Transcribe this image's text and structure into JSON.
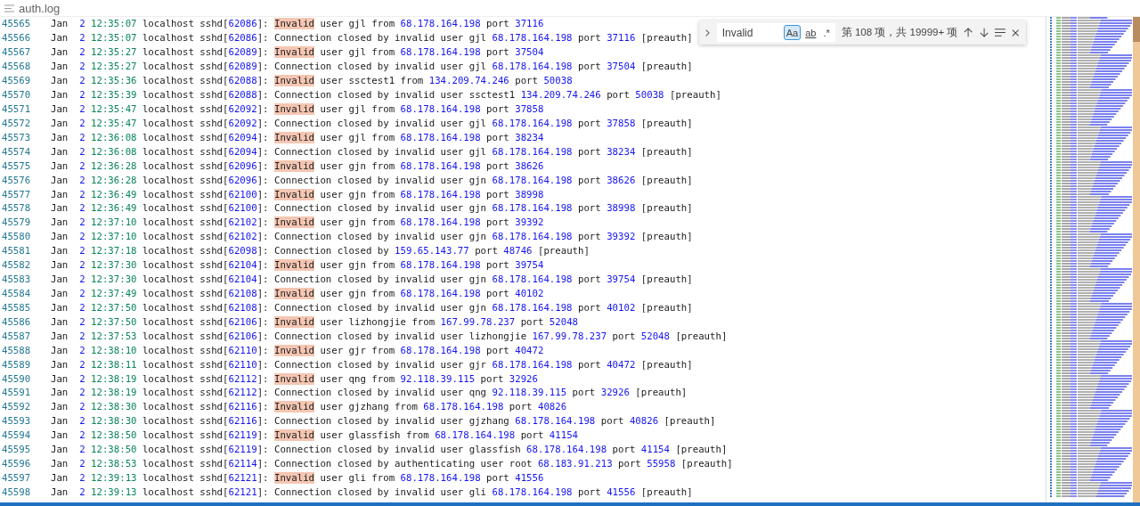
{
  "tab": {
    "title": "auth.log"
  },
  "find": {
    "value": "Invalid",
    "toggles": [
      {
        "label": "Aa",
        "kind": "case",
        "selected": true
      },
      {
        "label": "ab",
        "kind": "word",
        "selected": false
      },
      {
        "label": ".*",
        "kind": "regex",
        "selected": false
      }
    ],
    "results": "第 108 项，共 19999+ 项"
  },
  "lines": [
    {
      "number": "45565",
      "month": "Jan",
      "day": "2",
      "time": "12:35:07",
      "host": "localhost",
      "process": "sshd[",
      "pid": "62086",
      "close": "]:",
      "message": [
        {
          "kind": "match",
          "text": "Invalid"
        },
        {
          "kind": "text",
          "text": " user gjl from "
        },
        {
          "kind": "number",
          "text": "68.178.164.198"
        },
        {
          "kind": "text",
          "text": " port "
        },
        {
          "kind": "number",
          "text": "37116"
        }
      ]
    },
    {
      "number": "45566",
      "month": "Jan",
      "day": "2",
      "time": "12:35:07",
      "host": "localhost",
      "process": "sshd[",
      "pid": "62086",
      "close": "]:",
      "message": [
        {
          "kind": "text",
          "text": "Connection closed by invalid user gjl "
        },
        {
          "kind": "number",
          "text": "68.178.164.198"
        },
        {
          "kind": "text",
          "text": " port "
        },
        {
          "kind": "number",
          "text": "37116"
        },
        {
          "kind": "text",
          "text": " [preauth]"
        }
      ]
    },
    {
      "number": "45567",
      "month": "Jan",
      "day": "2",
      "time": "12:35:27",
      "host": "localhost",
      "process": "sshd[",
      "pid": "62089",
      "close": "]:",
      "message": [
        {
          "kind": "match",
          "text": "Invalid"
        },
        {
          "kind": "text",
          "text": " user gjl from "
        },
        {
          "kind": "number",
          "text": "68.178.164.198"
        },
        {
          "kind": "text",
          "text": " port "
        },
        {
          "kind": "number",
          "text": "37504"
        }
      ]
    },
    {
      "number": "45568",
      "month": "Jan",
      "day": "2",
      "time": "12:35:27",
      "host": "localhost",
      "process": "sshd[",
      "pid": "62089",
      "close": "]:",
      "message": [
        {
          "kind": "text",
          "text": "Connection closed by invalid user gjl "
        },
        {
          "kind": "number",
          "text": "68.178.164.198"
        },
        {
          "kind": "text",
          "text": " port "
        },
        {
          "kind": "number",
          "text": "37504"
        },
        {
          "kind": "text",
          "text": " [preauth]"
        }
      ]
    },
    {
      "number": "45569",
      "month": "Jan",
      "day": "2",
      "time": "12:35:36",
      "host": "localhost",
      "process": "sshd[",
      "pid": "62088",
      "close": "]:",
      "message": [
        {
          "kind": "match",
          "text": "Invalid"
        },
        {
          "kind": "text",
          "text": " user ssctest1 from "
        },
        {
          "kind": "number",
          "text": "134.209.74.246"
        },
        {
          "kind": "text",
          "text": " port "
        },
        {
          "kind": "number",
          "text": "50038"
        }
      ]
    },
    {
      "number": "45570",
      "month": "Jan",
      "day": "2",
      "time": "12:35:39",
      "host": "localhost",
      "process": "sshd[",
      "pid": "62088",
      "close": "]:",
      "message": [
        {
          "kind": "text",
          "text": "Connection closed by invalid user ssctest1 "
        },
        {
          "kind": "number",
          "text": "134.209.74.246"
        },
        {
          "kind": "text",
          "text": " port "
        },
        {
          "kind": "number",
          "text": "50038"
        },
        {
          "kind": "text",
          "text": " [preauth]"
        }
      ]
    },
    {
      "number": "45571",
      "month": "Jan",
      "day": "2",
      "time": "12:35:47",
      "host": "localhost",
      "process": "sshd[",
      "pid": "62092",
      "close": "]:",
      "message": [
        {
          "kind": "match",
          "text": "Invalid"
        },
        {
          "kind": "text",
          "text": " user gjl from "
        },
        {
          "kind": "number",
          "text": "68.178.164.198"
        },
        {
          "kind": "text",
          "text": " port "
        },
        {
          "kind": "number",
          "text": "37858"
        }
      ]
    },
    {
      "number": "45572",
      "month": "Jan",
      "day": "2",
      "time": "12:35:47",
      "host": "localhost",
      "process": "sshd[",
      "pid": "62092",
      "close": "]:",
      "message": [
        {
          "kind": "text",
          "text": "Connection closed by invalid user gjl "
        },
        {
          "kind": "number",
          "text": "68.178.164.198"
        },
        {
          "kind": "text",
          "text": " port "
        },
        {
          "kind": "number",
          "text": "37858"
        },
        {
          "kind": "text",
          "text": " [preauth]"
        }
      ]
    },
    {
      "number": "45573",
      "month": "Jan",
      "day": "2",
      "time": "12:36:08",
      "host": "localhost",
      "process": "sshd[",
      "pid": "62094",
      "close": "]:",
      "message": [
        {
          "kind": "match",
          "text": "Invalid"
        },
        {
          "kind": "text",
          "text": " user gjl from "
        },
        {
          "kind": "number",
          "text": "68.178.164.198"
        },
        {
          "kind": "text",
          "text": " port "
        },
        {
          "kind": "number",
          "text": "38234"
        }
      ]
    },
    {
      "number": "45574",
      "month": "Jan",
      "day": "2",
      "time": "12:36:08",
      "host": "localhost",
      "process": "sshd[",
      "pid": "62094",
      "close": "]:",
      "message": [
        {
          "kind": "text",
          "text": "Connection closed by invalid user gjl "
        },
        {
          "kind": "number",
          "text": "68.178.164.198"
        },
        {
          "kind": "text",
          "text": " port "
        },
        {
          "kind": "number",
          "text": "38234"
        },
        {
          "kind": "text",
          "text": " [preauth]"
        }
      ]
    },
    {
      "number": "45575",
      "month": "Jan",
      "day": "2",
      "time": "12:36:28",
      "host": "localhost",
      "process": "sshd[",
      "pid": "62096",
      "close": "]:",
      "message": [
        {
          "kind": "match",
          "text": "Invalid"
        },
        {
          "kind": "text",
          "text": " user gjn from "
        },
        {
          "kind": "number",
          "text": "68.178.164.198"
        },
        {
          "kind": "text",
          "text": " port "
        },
        {
          "kind": "number",
          "text": "38626"
        }
      ]
    },
    {
      "number": "45576",
      "month": "Jan",
      "day": "2",
      "time": "12:36:28",
      "host": "localhost",
      "process": "sshd[",
      "pid": "62096",
      "close": "]:",
      "message": [
        {
          "kind": "text",
          "text": "Connection closed by invalid user gjn "
        },
        {
          "kind": "number",
          "text": "68.178.164.198"
        },
        {
          "kind": "text",
          "text": " port "
        },
        {
          "kind": "number",
          "text": "38626"
        },
        {
          "kind": "text",
          "text": " [preauth]"
        }
      ]
    },
    {
      "number": "45577",
      "month": "Jan",
      "day": "2",
      "time": "12:36:49",
      "host": "localhost",
      "process": "sshd[",
      "pid": "62100",
      "close": "]:",
      "message": [
        {
          "kind": "match",
          "text": "Invalid"
        },
        {
          "kind": "text",
          "text": " user gjn from "
        },
        {
          "kind": "number",
          "text": "68.178.164.198"
        },
        {
          "kind": "text",
          "text": " port "
        },
        {
          "kind": "number",
          "text": "38998"
        }
      ]
    },
    {
      "number": "45578",
      "month": "Jan",
      "day": "2",
      "time": "12:36:49",
      "host": "localhost",
      "process": "sshd[",
      "pid": "62100",
      "close": "]:",
      "message": [
        {
          "kind": "text",
          "text": "Connection closed by invalid user gjn "
        },
        {
          "kind": "number",
          "text": "68.178.164.198"
        },
        {
          "kind": "text",
          "text": " port "
        },
        {
          "kind": "number",
          "text": "38998"
        },
        {
          "kind": "text",
          "text": " [preauth]"
        }
      ]
    },
    {
      "number": "45579",
      "month": "Jan",
      "day": "2",
      "time": "12:37:10",
      "host": "localhost",
      "process": "sshd[",
      "pid": "62102",
      "close": "]:",
      "message": [
        {
          "kind": "match",
          "text": "Invalid"
        },
        {
          "kind": "text",
          "text": " user gjn from "
        },
        {
          "kind": "number",
          "text": "68.178.164.198"
        },
        {
          "kind": "text",
          "text": " port "
        },
        {
          "kind": "number",
          "text": "39392"
        }
      ]
    },
    {
      "number": "45580",
      "month": "Jan",
      "day": "2",
      "time": "12:37:10",
      "host": "localhost",
      "process": "sshd[",
      "pid": "62102",
      "close": "]:",
      "message": [
        {
          "kind": "text",
          "text": "Connection closed by invalid user gjn "
        },
        {
          "kind": "number",
          "text": "68.178.164.198"
        },
        {
          "kind": "text",
          "text": " port "
        },
        {
          "kind": "number",
          "text": "39392"
        },
        {
          "kind": "text",
          "text": " [preauth]"
        }
      ]
    },
    {
      "number": "45581",
      "month": "Jan",
      "day": "2",
      "time": "12:37:18",
      "host": "localhost",
      "process": "sshd[",
      "pid": "62098",
      "close": "]:",
      "message": [
        {
          "kind": "text",
          "text": "Connection closed by "
        },
        {
          "kind": "number",
          "text": "159.65.143.77"
        },
        {
          "kind": "text",
          "text": " port "
        },
        {
          "kind": "number",
          "text": "48746"
        },
        {
          "kind": "text",
          "text": " [preauth]"
        }
      ]
    },
    {
      "number": "45582",
      "month": "Jan",
      "day": "2",
      "time": "12:37:30",
      "host": "localhost",
      "process": "sshd[",
      "pid": "62104",
      "close": "]:",
      "message": [
        {
          "kind": "match",
          "text": "Invalid"
        },
        {
          "kind": "text",
          "text": " user gjn from "
        },
        {
          "kind": "number",
          "text": "68.178.164.198"
        },
        {
          "kind": "text",
          "text": " port "
        },
        {
          "kind": "number",
          "text": "39754"
        }
      ]
    },
    {
      "number": "45583",
      "month": "Jan",
      "day": "2",
      "time": "12:37:30",
      "host": "localhost",
      "process": "sshd[",
      "pid": "62104",
      "close": "]:",
      "message": [
        {
          "kind": "text",
          "text": "Connection closed by invalid user gjn "
        },
        {
          "kind": "number",
          "text": "68.178.164.198"
        },
        {
          "kind": "text",
          "text": " port "
        },
        {
          "kind": "number",
          "text": "39754"
        },
        {
          "kind": "text",
          "text": " [preauth]"
        }
      ]
    },
    {
      "number": "45584",
      "month": "Jan",
      "day": "2",
      "time": "12:37:49",
      "host": "localhost",
      "process": "sshd[",
      "pid": "62108",
      "close": "]:",
      "message": [
        {
          "kind": "match",
          "text": "Invalid"
        },
        {
          "kind": "text",
          "text": " user gjn from "
        },
        {
          "kind": "number",
          "text": "68.178.164.198"
        },
        {
          "kind": "text",
          "text": " port "
        },
        {
          "kind": "number",
          "text": "40102"
        }
      ]
    },
    {
      "number": "45585",
      "month": "Jan",
      "day": "2",
      "time": "12:37:50",
      "host": "localhost",
      "process": "sshd[",
      "pid": "62108",
      "close": "]:",
      "message": [
        {
          "kind": "text",
          "text": "Connection closed by invalid user gjn "
        },
        {
          "kind": "number",
          "text": "68.178.164.198"
        },
        {
          "kind": "text",
          "text": " port "
        },
        {
          "kind": "number",
          "text": "40102"
        },
        {
          "kind": "text",
          "text": " [preauth]"
        }
      ]
    },
    {
      "number": "45586",
      "month": "Jan",
      "day": "2",
      "time": "12:37:50",
      "host": "localhost",
      "process": "sshd[",
      "pid": "62106",
      "close": "]:",
      "message": [
        {
          "kind": "match",
          "text": "Invalid"
        },
        {
          "kind": "text",
          "text": " user lizhongjie from "
        },
        {
          "kind": "number",
          "text": "167.99.78.237"
        },
        {
          "kind": "text",
          "text": " port "
        },
        {
          "kind": "number",
          "text": "52048"
        }
      ]
    },
    {
      "number": "45587",
      "month": "Jan",
      "day": "2",
      "time": "12:37:53",
      "host": "localhost",
      "process": "sshd[",
      "pid": "62106",
      "close": "]:",
      "message": [
        {
          "kind": "text",
          "text": "Connection closed by invalid user lizhongjie "
        },
        {
          "kind": "number",
          "text": "167.99.78.237"
        },
        {
          "kind": "text",
          "text": " port "
        },
        {
          "kind": "number",
          "text": "52048"
        },
        {
          "kind": "text",
          "text": " [preauth]"
        }
      ]
    },
    {
      "number": "45588",
      "month": "Jan",
      "day": "2",
      "time": "12:38:10",
      "host": "localhost",
      "process": "sshd[",
      "pid": "62110",
      "close": "]:",
      "message": [
        {
          "kind": "match",
          "text": "Invalid"
        },
        {
          "kind": "text",
          "text": " user gjr from "
        },
        {
          "kind": "number",
          "text": "68.178.164.198"
        },
        {
          "kind": "text",
          "text": " port "
        },
        {
          "kind": "number",
          "text": "40472"
        }
      ]
    },
    {
      "number": "45589",
      "month": "Jan",
      "day": "2",
      "time": "12:38:11",
      "host": "localhost",
      "process": "sshd[",
      "pid": "62110",
      "close": "]:",
      "message": [
        {
          "kind": "text",
          "text": "Connection closed by invalid user gjr "
        },
        {
          "kind": "number",
          "text": "68.178.164.198"
        },
        {
          "kind": "text",
          "text": " port "
        },
        {
          "kind": "number",
          "text": "40472"
        },
        {
          "kind": "text",
          "text": " [preauth]"
        }
      ]
    },
    {
      "number": "45590",
      "month": "Jan",
      "day": "2",
      "time": "12:38:19",
      "host": "localhost",
      "process": "sshd[",
      "pid": "62112",
      "close": "]:",
      "message": [
        {
          "kind": "match",
          "text": "Invalid"
        },
        {
          "kind": "text",
          "text": " user qng from "
        },
        {
          "kind": "number",
          "text": "92.118.39.115"
        },
        {
          "kind": "text",
          "text": " port "
        },
        {
          "kind": "number",
          "text": "32926"
        }
      ]
    },
    {
      "number": "45591",
      "month": "Jan",
      "day": "2",
      "time": "12:38:19",
      "host": "localhost",
      "process": "sshd[",
      "pid": "62112",
      "close": "]:",
      "message": [
        {
          "kind": "text",
          "text": "Connection closed by invalid user qng "
        },
        {
          "kind": "number",
          "text": "92.118.39.115"
        },
        {
          "kind": "text",
          "text": " port "
        },
        {
          "kind": "number",
          "text": "32926"
        },
        {
          "kind": "text",
          "text": " [preauth]"
        }
      ]
    },
    {
      "number": "45592",
      "month": "Jan",
      "day": "2",
      "time": "12:38:30",
      "host": "localhost",
      "process": "sshd[",
      "pid": "62116",
      "close": "]:",
      "message": [
        {
          "kind": "match",
          "text": "Invalid"
        },
        {
          "kind": "text",
          "text": " user gjzhang from "
        },
        {
          "kind": "number",
          "text": "68.178.164.198"
        },
        {
          "kind": "text",
          "text": " port "
        },
        {
          "kind": "number",
          "text": "40826"
        }
      ]
    },
    {
      "number": "45593",
      "month": "Jan",
      "day": "2",
      "time": "12:38:30",
      "host": "localhost",
      "process": "sshd[",
      "pid": "62116",
      "close": "]:",
      "message": [
        {
          "kind": "text",
          "text": "Connection closed by invalid user gjzhang "
        },
        {
          "kind": "number",
          "text": "68.178.164.198"
        },
        {
          "kind": "text",
          "text": " port "
        },
        {
          "kind": "number",
          "text": "40826"
        },
        {
          "kind": "text",
          "text": " [preauth]"
        }
      ]
    },
    {
      "number": "45594",
      "month": "Jan",
      "day": "2",
      "time": "12:38:50",
      "host": "localhost",
      "process": "sshd[",
      "pid": "62119",
      "close": "]:",
      "message": [
        {
          "kind": "match",
          "text": "Invalid"
        },
        {
          "kind": "text",
          "text": " user glassfish from "
        },
        {
          "kind": "number",
          "text": "68.178.164.198"
        },
        {
          "kind": "text",
          "text": " port "
        },
        {
          "kind": "number",
          "text": "41154"
        }
      ]
    },
    {
      "number": "45595",
      "month": "Jan",
      "day": "2",
      "time": "12:38:50",
      "host": "localhost",
      "process": "sshd[",
      "pid": "62119",
      "close": "]:",
      "message": [
        {
          "kind": "text",
          "text": "Connection closed by invalid user glassfish "
        },
        {
          "kind": "number",
          "text": "68.178.164.198"
        },
        {
          "kind": "text",
          "text": " port "
        },
        {
          "kind": "number",
          "text": "41154"
        },
        {
          "kind": "text",
          "text": " [preauth]"
        }
      ]
    },
    {
      "number": "45596",
      "month": "Jan",
      "day": "2",
      "time": "12:38:53",
      "host": "localhost",
      "process": "sshd[",
      "pid": "62114",
      "close": "]:",
      "message": [
        {
          "kind": "text",
          "text": "Connection closed by authenticating user root "
        },
        {
          "kind": "number",
          "text": "68.183.91.213"
        },
        {
          "kind": "text",
          "text": " port "
        },
        {
          "kind": "number",
          "text": "55958"
        },
        {
          "kind": "text",
          "text": " [preauth]"
        }
      ]
    },
    {
      "number": "45597",
      "month": "Jan",
      "day": "2",
      "time": "12:39:13",
      "host": "localhost",
      "process": "sshd[",
      "pid": "62121",
      "close": "]:",
      "message": [
        {
          "kind": "match",
          "text": "Invalid"
        },
        {
          "kind": "text",
          "text": " user gli from "
        },
        {
          "kind": "number",
          "text": "68.178.164.198"
        },
        {
          "kind": "text",
          "text": " port "
        },
        {
          "kind": "number",
          "text": "41556"
        }
      ]
    },
    {
      "number": "45598",
      "month": "Jan",
      "day": "2",
      "time": "12:39:13",
      "host": "localhost",
      "process": "sshd[",
      "pid": "62121",
      "close": "]:",
      "message": [
        {
          "kind": "text",
          "text": "Connection closed by invalid user gli "
        },
        {
          "kind": "number",
          "text": "68.178.164.198"
        },
        {
          "kind": "text",
          "text": " port "
        },
        {
          "kind": "number",
          "text": "41556"
        },
        {
          "kind": "text",
          "text": " [preauth]"
        }
      ]
    }
  ]
}
